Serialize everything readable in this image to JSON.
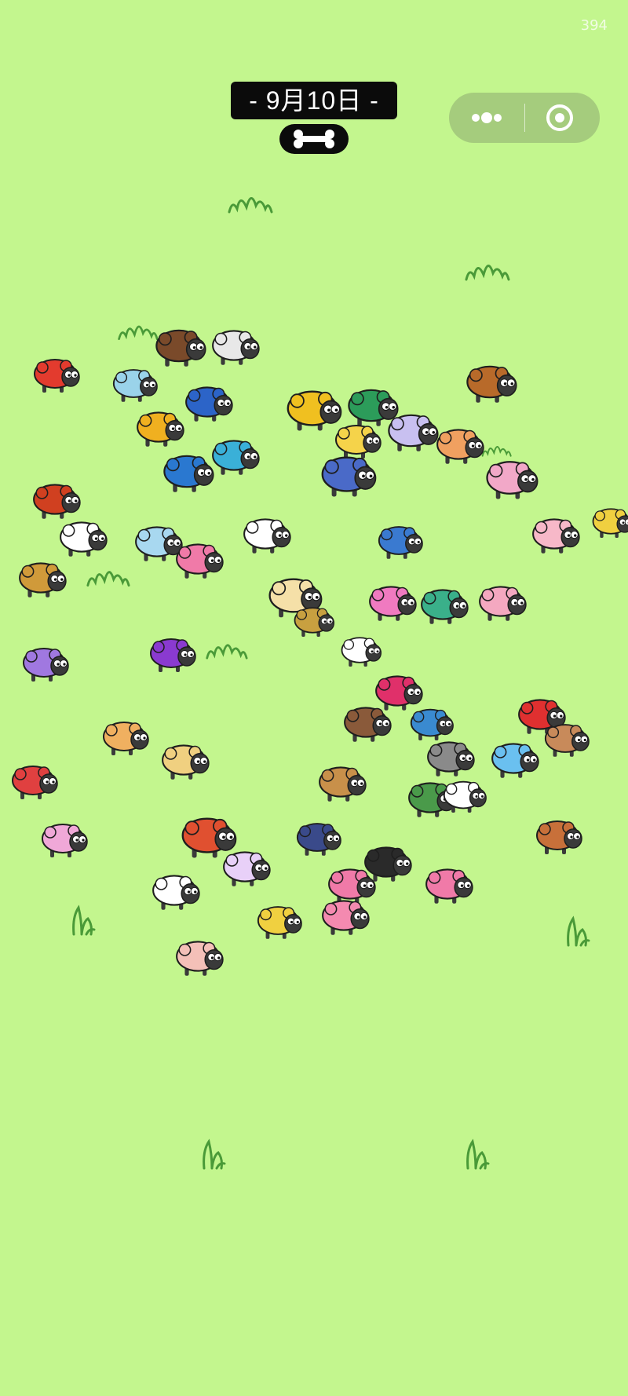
{
  "header": {
    "counter": "394",
    "date_label": "- 9月10日 -"
  },
  "capsule": {
    "more_icon": "more-dots-icon",
    "close_icon": "target-close-icon"
  },
  "colors": {
    "background": "#c3f68e",
    "grass_stroke": "#4a9a38",
    "banner": "#0b0b0b",
    "sheep_face": "#3a3a3a"
  },
  "sheep": [
    {
      "name": "alarm-clock",
      "color": "#e33b2e"
    },
    {
      "name": "pig-suitcase",
      "color": "#9ad3ea"
    },
    {
      "name": "waffle-cake",
      "color": "#7a4a2a"
    },
    {
      "name": "milk-can",
      "color": "#e8e8e8"
    },
    {
      "name": "treasure-chest",
      "color": "#b86a2a"
    },
    {
      "name": "excavator",
      "color": "#f0c020"
    },
    {
      "name": "subway-train",
      "color": "#2c9c5a"
    },
    {
      "name": "lavender-cloud",
      "color": "#c8c0f0"
    },
    {
      "name": "hamster",
      "color": "#f0a060"
    },
    {
      "name": "pink-elephant",
      "color": "#f2a8c8"
    },
    {
      "name": "camera",
      "color": "#2c64c8"
    },
    {
      "name": "honey-jar",
      "color": "#f0b020"
    },
    {
      "name": "popcorn-tub",
      "color": "#f5d34a"
    },
    {
      "name": "plaid-scarf",
      "color": "#4a6ac8"
    },
    {
      "name": "octopus",
      "color": "#3ab0d8"
    },
    {
      "name": "blue-whale",
      "color": "#2a78d0"
    },
    {
      "name": "warrior-helmet",
      "color": "#d04020"
    },
    {
      "name": "white-fluffy",
      "color": "#ffffff"
    },
    {
      "name": "blue-cloud",
      "color": "#a8d8f0"
    },
    {
      "name": "pink-fluffy",
      "color": "#f07aa8"
    },
    {
      "name": "cow-spots",
      "color": "#ffffff"
    },
    {
      "name": "wall-clock",
      "color": "#3a7ad0"
    },
    {
      "name": "pink-donkey",
      "color": "#f7b8c8"
    },
    {
      "name": "bee",
      "color": "#f0d040"
    },
    {
      "name": "lion-mane",
      "color": "#d09a3a"
    },
    {
      "name": "ice-cream-barrel",
      "color": "#f5e0a8"
    },
    {
      "name": "pretzel-shield",
      "color": "#c8a040"
    },
    {
      "name": "candy-jar",
      "color": "#f07ac0"
    },
    {
      "name": "green-machine",
      "color": "#3ab08a"
    },
    {
      "name": "pink-dotted",
      "color": "#f4a8c0"
    },
    {
      "name": "rainbow-headphones",
      "color": "#a078e0"
    },
    {
      "name": "grape-bunch",
      "color": "#8a3ad0"
    },
    {
      "name": "bunny-ears",
      "color": "#ffffff"
    },
    {
      "name": "dragon-fruit",
      "color": "#e0306a"
    },
    {
      "name": "deer-antlers",
      "color": "#8a5a3a"
    },
    {
      "name": "astronaut-helmet",
      "color": "#3a8ad0"
    },
    {
      "name": "koala",
      "color": "#8a8a8a"
    },
    {
      "name": "ladybug",
      "color": "#e03030"
    },
    {
      "name": "bubble-tea",
      "color": "#c88a5a"
    },
    {
      "name": "blue-fluffy",
      "color": "#6ac0f0"
    },
    {
      "name": "toast-bread",
      "color": "#f0b060"
    },
    {
      "name": "ramen-bowl",
      "color": "#f0d080"
    },
    {
      "name": "picnic-basket",
      "color": "#c8904a"
    },
    {
      "name": "forest-scene",
      "color": "#4a9a4a"
    },
    {
      "name": "sheep-char",
      "color": "#ffffff"
    },
    {
      "name": "burger",
      "color": "#c8703a"
    },
    {
      "name": "ferris-wheel",
      "color": "#e04040"
    },
    {
      "name": "unicorn-rainbow",
      "color": "#f0a8d8"
    },
    {
      "name": "fire-engine",
      "color": "#e05030"
    },
    {
      "name": "bandana-hat",
      "color": "#3a4a8a"
    },
    {
      "name": "unicorn-horn",
      "color": "#e8d0f8"
    },
    {
      "name": "gift-pink",
      "color": "#f07aa8"
    },
    {
      "name": "black-white-cat",
      "color": "#2a2a2a"
    },
    {
      "name": "flamingo-duck",
      "color": "#f07aa8"
    },
    {
      "name": "snowman",
      "color": "#ffffff"
    },
    {
      "name": "chick-hat",
      "color": "#f0d040"
    },
    {
      "name": "heart-pink",
      "color": "#f48ab0"
    },
    {
      "name": "seashell",
      "color": "#f4c0b8"
    }
  ]
}
